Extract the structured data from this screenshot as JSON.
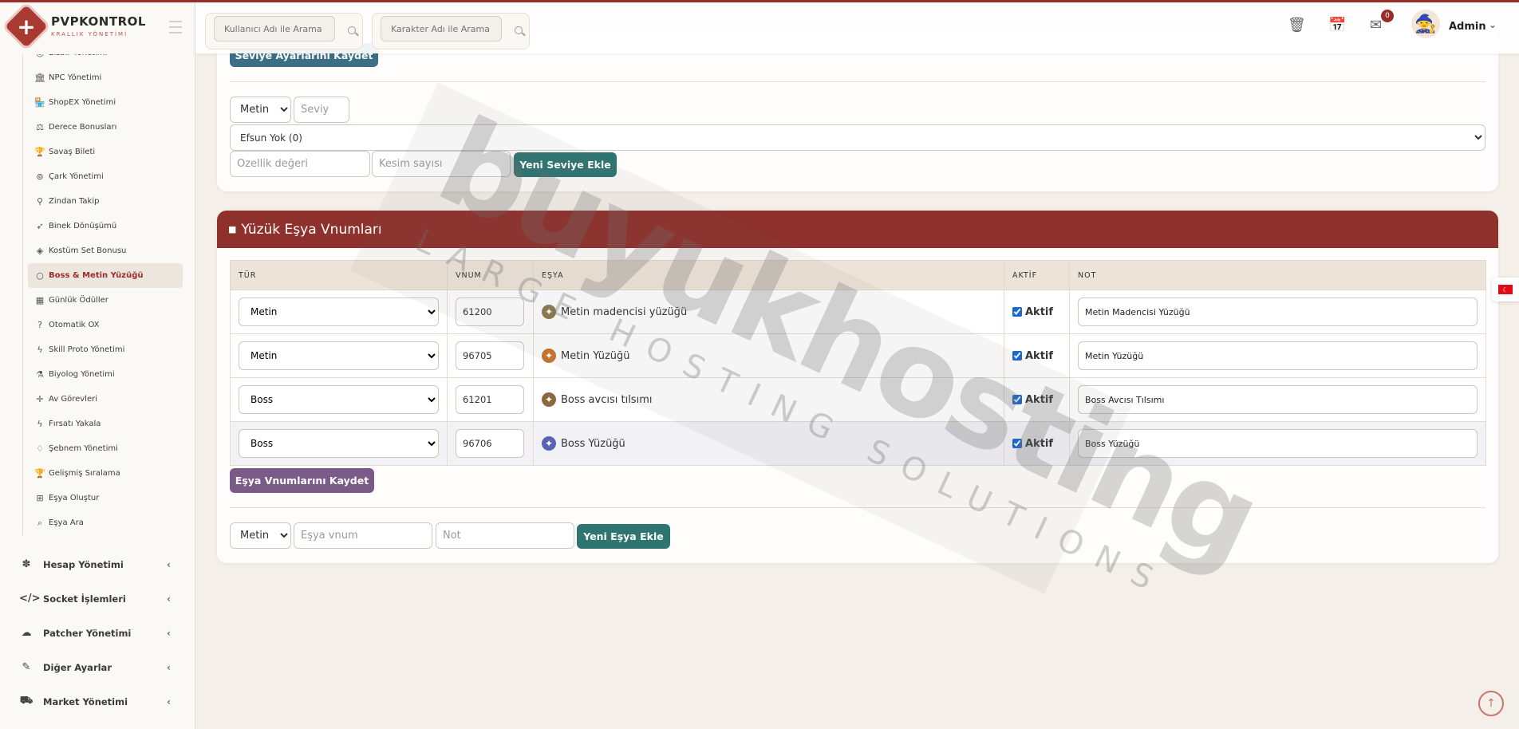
{
  "brand": {
    "name": "PVPKONTROL",
    "subtitle": "KRALLIK YÖNETİMİ"
  },
  "header": {
    "search_user_placeholder": "Kullanıcı Adı ile Arama",
    "search_char_placeholder": "Karakter Adı ile Arama",
    "notification_count": "0",
    "admin_name": "Admin"
  },
  "sidebar": {
    "sub_items": [
      {
        "label": "Elsbir Yönetimi",
        "icon": "coin-icon"
      },
      {
        "label": "NPC Yönetimi",
        "icon": "bank-icon"
      },
      {
        "label": "ShopEX Yönetimi",
        "icon": "shop-icon"
      },
      {
        "label": "Derece Bonusları",
        "icon": "scale-icon"
      },
      {
        "label": "Savaş Bileti",
        "icon": "trophy-icon"
      },
      {
        "label": "Çark Yönetimi",
        "icon": "wheel-icon"
      },
      {
        "label": "Zindan Takip",
        "icon": "pin-icon"
      },
      {
        "label": "Binek Dönüşümü",
        "icon": "rocket-icon"
      },
      {
        "label": "Kostüm Set Bonusu",
        "icon": "gem-icon"
      },
      {
        "label": "Boss & Metin Yüzüğü",
        "icon": "ring-icon"
      },
      {
        "label": "Günlük Ödüller",
        "icon": "calendar-icon"
      },
      {
        "label": "Otomatik OX",
        "icon": "question-icon"
      },
      {
        "label": "Skill Proto Yönetimi",
        "icon": "bolt-icon"
      },
      {
        "label": "Biyolog Yönetimi",
        "icon": "flask-icon"
      },
      {
        "label": "Av Görevleri",
        "icon": "crosshair-icon"
      },
      {
        "label": "Fırsatı Yakala",
        "icon": "bolt-icon"
      },
      {
        "label": "Şebnem Yönetimi",
        "icon": "drop-icon"
      },
      {
        "label": "Gelişmiş Sıralama",
        "icon": "trophy-icon"
      },
      {
        "label": "Eşya Oluştur",
        "icon": "gift-icon"
      },
      {
        "label": "Eşya Ara",
        "icon": "search-icon"
      }
    ],
    "active_index": 9,
    "main_items": [
      {
        "label": "Hesap Yönetimi",
        "icon": "paw-icon"
      },
      {
        "label": "Socket İşlemleri",
        "icon": "code-icon"
      },
      {
        "label": "Patcher Yönetimi",
        "icon": "cloud-icon"
      },
      {
        "label": "Diğer Ayarlar",
        "icon": "wrench-icon"
      },
      {
        "label": "Market Yönetimi",
        "icon": "cart-icon"
      }
    ]
  },
  "level_card": {
    "save_button": "Seviye Ayarlarını Kaydet",
    "type_select": "Metin",
    "level_placeholder": "Seviy",
    "efsun_select": "Efsun Yok (0)",
    "value_placeholder": "Özellik değeri",
    "count_placeholder": "Kesim sayısı",
    "add_button": "Yeni Seviye Ekle"
  },
  "ring_card": {
    "title": "Yüzük Eşya Vnumları",
    "columns": [
      "TÜR",
      "VNUM",
      "EŞYA",
      "AKTİF",
      "NOT"
    ],
    "rows": [
      {
        "type": "Metin",
        "vnum": "61200",
        "item": "Metin madencisi yüzüğü",
        "active": "Aktif",
        "note": "Metin Madencisi Yüzüğü",
        "icon": "gear-ring-icon",
        "icon_color": "#8a7a4c"
      },
      {
        "type": "Metin",
        "vnum": "96705",
        "item": "Metin Yüzüğü",
        "active": "Aktif",
        "note": "Metin Yüzüğü",
        "icon": "orange-ring-icon",
        "icon_color": "#c8762a"
      },
      {
        "type": "Boss",
        "vnum": "61201",
        "item": "Boss avcısı tılsımı",
        "active": "Aktif",
        "note": "Boss Avcısı Tılsımı",
        "icon": "gear-ring-icon",
        "icon_color": "#8a6a3c"
      },
      {
        "type": "Boss",
        "vnum": "96706",
        "item": "Boss Yüzüğü",
        "active": "Aktif",
        "note": "Boss Yüzüğü",
        "icon": "blue-ring-icon",
        "icon_color": "#5a62b8"
      }
    ],
    "save_button": "Eşya Vnumlarını Kaydet",
    "new_type_select": "Metin",
    "vnum_placeholder": "Eşya vnum",
    "note_placeholder": "Not",
    "add_button": "Yeni Eşya Ekle"
  },
  "watermark": {
    "main": "buyukhosting",
    "sub": "LARGE HOSTING SOLUTIONS"
  },
  "colors": {
    "accent": "#8e302c",
    "teal": "#2e7571",
    "purple": "#7a5a86",
    "blue": "#3c6e86"
  }
}
